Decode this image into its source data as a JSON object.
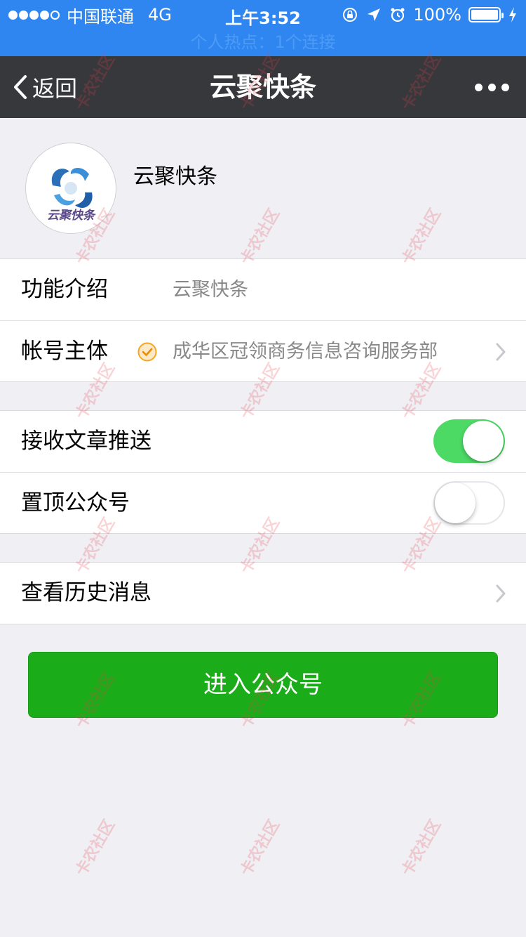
{
  "status_bar": {
    "signal_dots_filled": 4,
    "signal_dots_total": 5,
    "carrier": "中国联通",
    "network": "4G",
    "time": "上午3:52",
    "battery": "100%",
    "hotspot_banner": "个人热点：1个连接"
  },
  "nav": {
    "back_label": "返回",
    "title": "云聚快条"
  },
  "profile": {
    "name": "云聚快条",
    "avatar_text": "云聚快条"
  },
  "info": {
    "intro_label": "功能介绍",
    "intro_value": "云聚快条",
    "entity_label": "帐号主体",
    "entity_value": "成华区冠领商务信息咨询服务部"
  },
  "settings": {
    "receive_push_label": "接收文章推送",
    "receive_push_on": true,
    "pin_top_label": "置顶公众号",
    "pin_top_on": false
  },
  "history": {
    "label": "查看历史消息"
  },
  "enter_button": "进入公众号",
  "watermark": "卡农社区",
  "colors": {
    "status_bar": "#2f86f0",
    "nav_bar": "#37383c",
    "background": "#efeff4",
    "switch_on": "#4cd964",
    "primary_button": "#1aad19",
    "verify_badge": "#f5a623"
  }
}
